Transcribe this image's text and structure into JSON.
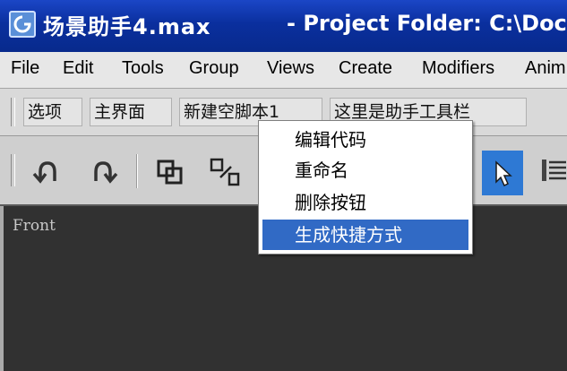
{
  "window": {
    "title": "场景助手4.max",
    "subtitle": "- Project Folder: C:\\Docu"
  },
  "menu": [
    "File",
    "Edit",
    "Tools",
    "Group",
    "Views",
    "Create",
    "Modifiers",
    "Anim"
  ],
  "helper_toolbar": {
    "buttons": [
      "选项",
      "主界面",
      "新建空脚本1",
      "这里是助手工具栏"
    ]
  },
  "main_toolbar": {
    "icons": [
      "undo-icon",
      "redo-icon",
      "group-icon",
      "link-icon",
      "select-arrow-icon",
      "list-icon"
    ],
    "selected_color": "#2e79d4"
  },
  "viewport": {
    "label": "Front",
    "background": "#313131"
  },
  "context_menu": {
    "items": [
      "编辑代码",
      "重命名",
      "删除按钮",
      "生成快捷方式"
    ],
    "highlight_color": "#316ac5"
  }
}
